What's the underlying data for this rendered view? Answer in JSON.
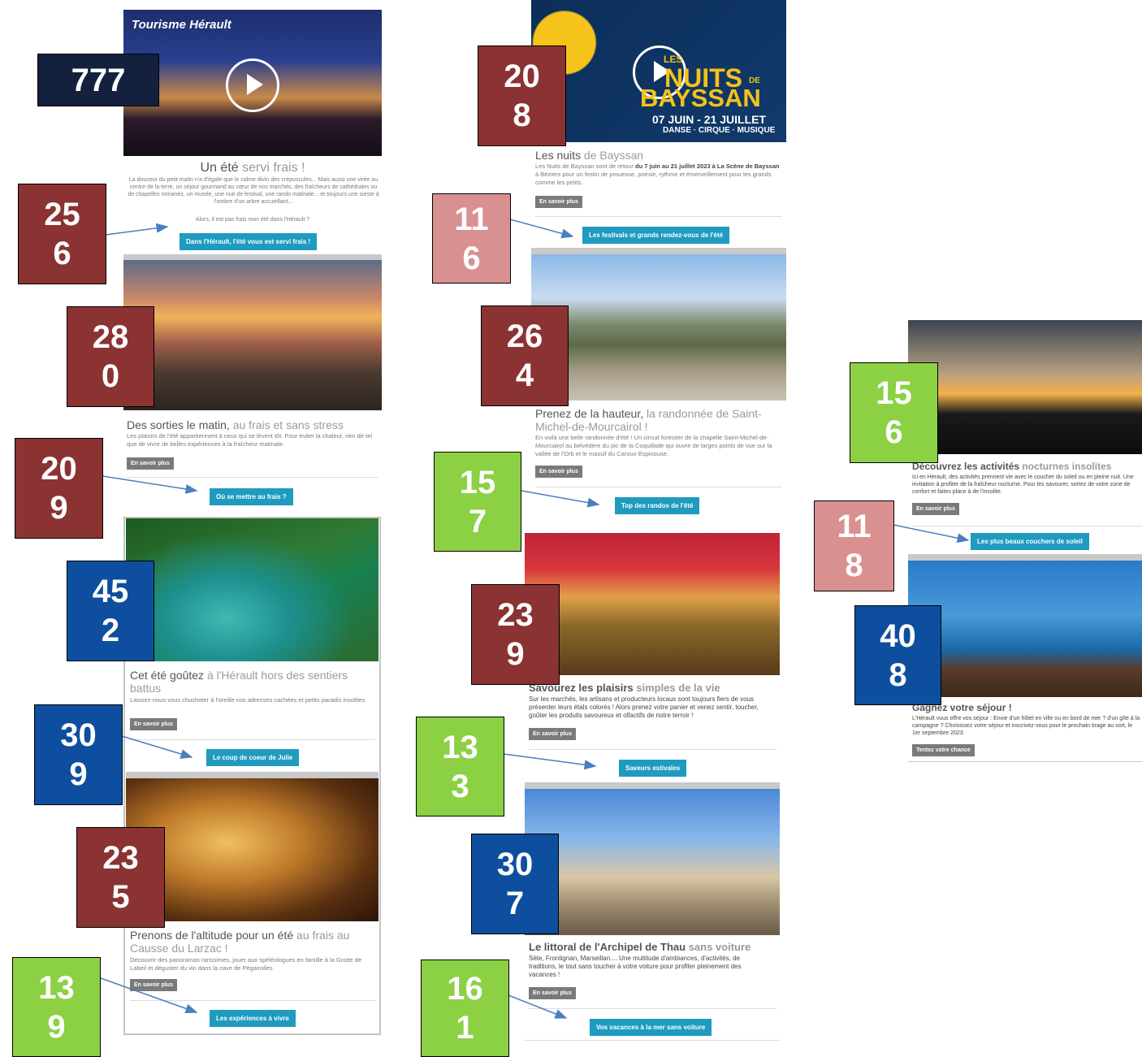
{
  "column1": {
    "brand_logo": "Tourisme Hérault",
    "hero_title_part1": "Un été ",
    "hero_title_part2": "servi frais !",
    "hero_text": "La douceur du petit matin n'a d'égale que le calme divin des crépuscules... Mais aussi une virée au centre de la terre, un séjour gourmand au cœur de nos marchés, des fraîcheurs de cathédrales ou de chapelles romanes, un musée, une nuit de festival, une rando matinale... et toujours une sieste à l'ombre d'un arbre accueillant...",
    "hero_question": "Alors, il est pas frais mon été dans l'Hérault ?",
    "hero_cta": "Dans l'Hérault, l'été vous est servi frais !",
    "s1_title_part1": "Des sorties le matin,",
    "s1_title_part2": " au frais et sans stress",
    "s1_text": "Les plaisirs de l'été appartiennent à ceux qui se lèvent tôt. Pour éviter la chaleur, rien de tel que de vivre de belles expériences à la fraîcheur matinale.",
    "s1_more": "En savoir plus",
    "s1_cta": "Où se mettre au frais ?",
    "s2_title_part1": "Cet été goûtez",
    "s2_title_part2": " à l'Hérault hors des sentiers battus",
    "s2_text": "Laissez-nous vous chuchoter à l'oreille nos adresses cachées et petits paradis insolites",
    "s2_more": "En savoir plus",
    "s2_cta": "Le coup de coeur de Julie",
    "s3_title_part1": "Prenons de l'altitude pour un été",
    "s3_title_part2": " au frais au Causse du Larzac !",
    "s3_text": "Découvrir des panoramas rarissimes, jouer aux spéléologues en famille à la Grotte de Labeil et déguster du vin dans la cave de Pégairolles.",
    "s3_more": "En savoir plus",
    "s3_cta": "Les expériences à vivre"
  },
  "column2": {
    "banner_les": "LES",
    "banner_title_line1": "NUITS",
    "banner_de": "DE",
    "banner_title_line2": "BAYSSAN",
    "banner_dates": "07 JUIN - 21 JUILLET",
    "banner_sub": "DANSE · CIRQUE · MUSIQUE",
    "n_title_part1": "Les nuits",
    "n_title_part2": " de Bayssan",
    "n_text_part1": "Les Nuits de Bayssan sont de retour ",
    "n_text_bold": "du 7 juin au 21 juillet 2023 à La Scène de Bayssan",
    "n_text_part2": " à Béziers pour un festin de prouesse, poésie, rythme et émerveillement pour les grands comme les petits.",
    "n_more": "En savoir plus",
    "n_cta": "Les festivals et grands rendez-vous de l'été",
    "r_title_part1": "Prenez de la hauteur,",
    "r_title_part2": " la randonnée de Saint-Michel-de-Mourcairol !",
    "r_text": "En voilà une belle randonnée d'été ! Un circuit forestier de la chapelle Saint-Michel-de-Mourcairol au belvédère du pic de la Coquillade qui ouvre de larges points de vue sur la vallée de l'Orb et le massif du Caroux-Espinouse.",
    "r_more": "En savoir plus",
    "r_cta": "Top des randos de l'été",
    "m_title_part1": "Savourez les plaisirs",
    "m_title_part2": " simples de la vie",
    "m_text": "Sur les marchés, les artisans et producteurs locaux sont toujours fiers de vous présenter leurs étals colorés ! Alors prenez votre panier et venez sentir, toucher, goûter les produits savoureux et olfactifs de notre terroir !",
    "m_more": "En savoir plus",
    "m_cta": "Saveurs estivales",
    "l_title_part1": "Le littoral de l'Archipel de Thau",
    "l_title_part2": " sans voiture",
    "l_text": "Sète, Frontignan, Marseillan.... Une multitude d'ambiances, d'activités, de traditions, le tout sans toucher à votre voiture pour profiter pleinement des vacances !",
    "l_more": "En savoir plus",
    "l_cta": "Vos vacances à la mer sans voiture"
  },
  "column3": {
    "a_title_part1": "Découvrez les activités",
    "a_title_part2": " nocturnes insolites",
    "a_text": "Ici en Hérault, des activités prennent vie avec le coucher du soleil ou en pleine nuit. Une invitation à profiter de la fraîcheur nocturne. Pour les savourer, sortez de votre zone de confort et faites place à de l'insolite.",
    "a_more": "En savoir plus",
    "a_cta": "Les plus beaux couchers de soleil",
    "g_title": "Gagnez votre séjour !",
    "g_text": "L'Hérault vous offre vos séjour : Envie d'un hôtel en ville ou en bord de mer ? d'un gîte à la campagne ? Choisissez votre séjour et inscrivez-vous pour le prochain tirage au sort, le 1er septembre 2023.",
    "g_cta": "Tentez votre chance"
  },
  "badges": {
    "b777": "777",
    "b256": "25\n6",
    "b280": "28\n0",
    "b209": "20\n9",
    "b452": "45\n2",
    "b309": "30\n9",
    "b235": "23\n5",
    "b139": "13\n9",
    "b208": "20\n8",
    "b116": "11\n6",
    "b264": "26\n4",
    "b157": "15\n7",
    "b239": "23\n9",
    "b133": "13\n3",
    "b307": "30\n7",
    "b161": "16\n1",
    "b156": "15\n6",
    "b118": "11\n8",
    "b408": "40\n8"
  },
  "colors": {
    "cta_blue": "#1e9bbf",
    "button_grey": "#7a7a7a",
    "badge_red": "#8b3232",
    "badge_pink": "#d99090",
    "badge_green": "#8cd044",
    "badge_blue": "#0d4f9e",
    "badge_navy": "#13213f"
  }
}
